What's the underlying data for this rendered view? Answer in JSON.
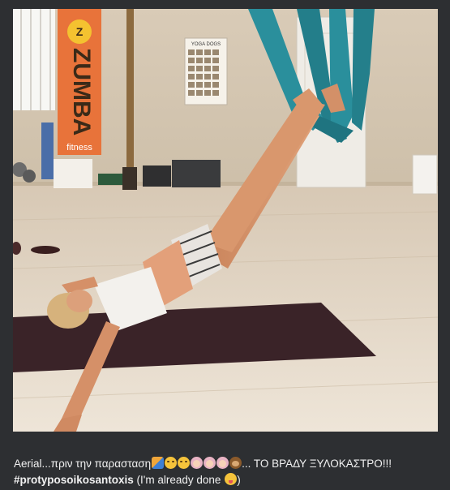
{
  "photo": {
    "poster_text": "ZUMBA",
    "poster_subtext": "fitness",
    "yoga_poster_title": "YOGA DOGS"
  },
  "caption": {
    "line1_prefix": "Aerial...πριν την παρασταση",
    "line1_suffix": "... ΤΟ ΒΡΑΔΥ ΞΥΛΟΚΑΣΤΡΟ!!!",
    "line2_hashtag": "#protyposoikosantoxis",
    "line2_text_open": " (I'm already done ",
    "line2_text_close": ")",
    "emoji_line1": [
      "masks-icon",
      "smirk-icon",
      "smirk-icon",
      "girl-face-icon",
      "girl-face-icon",
      "girl-face-icon",
      "monkey-face-icon"
    ],
    "emoji_line2": [
      "yum-face-icon"
    ]
  },
  "colors": {
    "background": "#2d2f32",
    "text": "#f1f1f1",
    "hammock": "#2a8f9c",
    "zumba_banner": "#e8733a",
    "mat": "#3a2328"
  }
}
